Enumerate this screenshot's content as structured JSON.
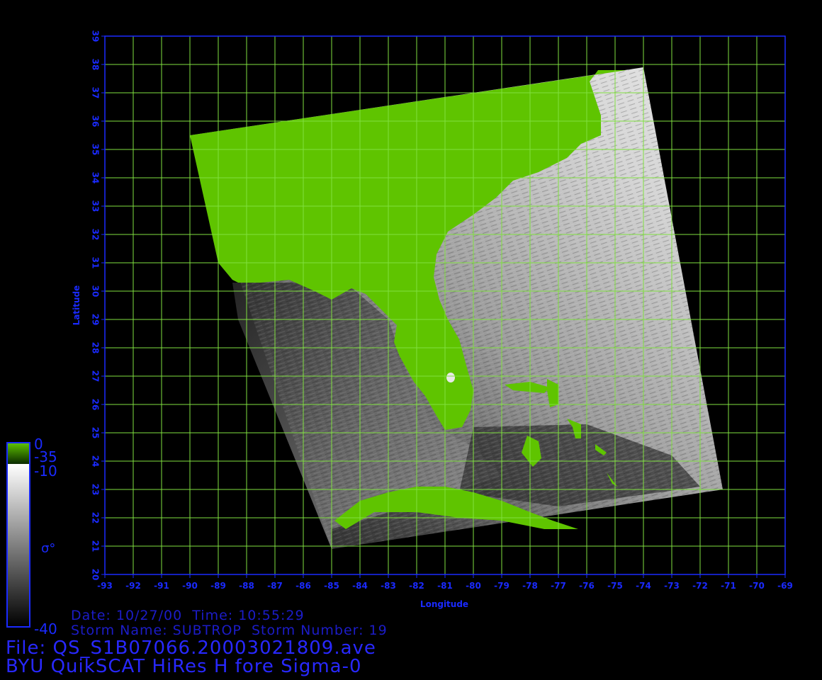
{
  "map": {
    "axes": {
      "xlabel": "Longitude",
      "ylabel": "Latitude",
      "lon_range": [
        -93,
        -69
      ],
      "lat_range": [
        20,
        39
      ],
      "lon_ticks": [
        "-93",
        "-92",
        "-91",
        "-90",
        "-89",
        "-88",
        "-87",
        "-86",
        "-85",
        "-84",
        "-83",
        "-82",
        "-81",
        "-80",
        "-79",
        "-78",
        "-77",
        "-76",
        "-75",
        "-74",
        "-73",
        "-72",
        "-71",
        "-70",
        "-69"
      ],
      "lat_ticks": [
        "20",
        "21",
        "22",
        "23",
        "24",
        "25",
        "26",
        "27",
        "28",
        "29",
        "30",
        "31",
        "32",
        "33",
        "34",
        "35",
        "36",
        "37",
        "38",
        "39"
      ],
      "grid": true
    },
    "swath_corners_lonlat": [
      [
        -90,
        35.5
      ],
      [
        -74,
        37.9
      ],
      [
        -71.2,
        23
      ],
      [
        -85,
        20.9
      ]
    ],
    "colors": {
      "land": "#5fc400",
      "grid": "#80e040",
      "axis": "#1a2aff",
      "ocean_light": "#c8c8c8",
      "ocean_dark": "#3a3a3a"
    },
    "colorbar": {
      "label": "σ°",
      "land_top_label": "0",
      "land_bottom_label": "-35",
      "max_label": "-10",
      "min_label": "-40"
    }
  },
  "info": {
    "line1": "Date: 10/27/00  Time: 10:55:29",
    "line2": "Storm Name: SUBTROP  Storm Number: 19",
    "file_line": "File: QS_S1B07066.20003021809.ave",
    "title_line": "BYU QuikSCAT HiRes H fore Sigma-0"
  }
}
